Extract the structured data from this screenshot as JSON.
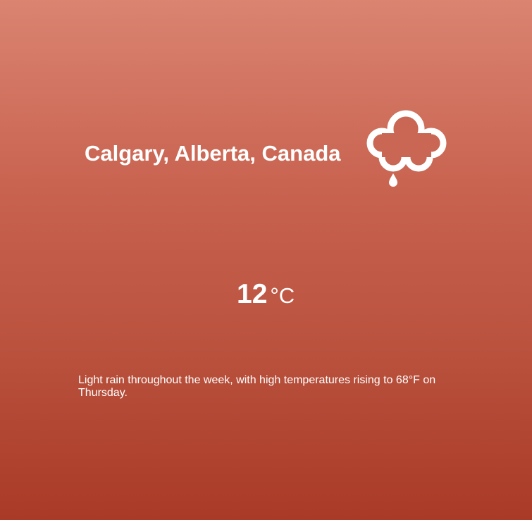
{
  "weather": {
    "location": "Calgary, Alberta, Canada",
    "icon": "cloud-rain-icon",
    "temperature": "12",
    "unit": "°C",
    "summary": "Light rain throughout the week, with high temperatures rising to 68°F on Thursday."
  },
  "colors": {
    "gradient_top": "#da8471",
    "gradient_bottom": "#a93a27",
    "text": "#ffffff"
  }
}
